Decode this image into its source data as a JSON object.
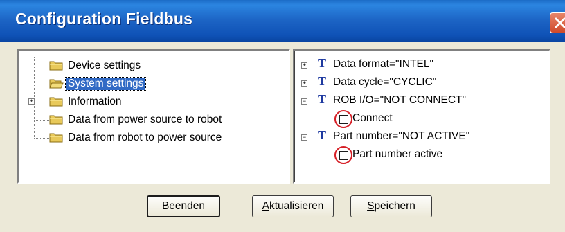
{
  "window": {
    "title": "Configuration Fieldbus"
  },
  "left_tree": {
    "items": [
      {
        "label": "Device settings",
        "selected": false,
        "expandable": false,
        "icon": "folder-icon"
      },
      {
        "label": "System settings",
        "selected": true,
        "expandable": false,
        "icon": "folder-icon"
      },
      {
        "label": "Information",
        "selected": false,
        "expandable": true,
        "icon": "folder-icon"
      },
      {
        "label": "Data from power source to robot",
        "selected": false,
        "expandable": false,
        "icon": "folder-icon"
      },
      {
        "label": "Data from robot to power source",
        "selected": false,
        "expandable": false,
        "icon": "folder-icon"
      }
    ]
  },
  "right_tree": {
    "items": [
      {
        "expander": "+",
        "type_icon": "T",
        "label": "Data format=\"INTEL\""
      },
      {
        "expander": "+",
        "type_icon": "T",
        "label": "Data cycle=\"CYCLIC\""
      },
      {
        "expander": "−",
        "type_icon": "T",
        "label": "ROB I/O=\"NOT CONNECT\""
      },
      {
        "checkbox": true,
        "checked": false,
        "label": "Connect"
      },
      {
        "expander": "−",
        "type_icon": "T",
        "label": "Part number=\"NOT ACTIVE\""
      },
      {
        "checkbox": true,
        "checked": false,
        "label": "Part number active"
      }
    ]
  },
  "buttons": {
    "beenden": "Beenden",
    "aktualisieren": "Aktualisieren",
    "speichern": "Speichern"
  },
  "colors": {
    "titlebar": "#1c63c4",
    "selection": "#316ac5",
    "highlight_circle": "#d61f26",
    "t_icon": "#1f3aa0"
  }
}
